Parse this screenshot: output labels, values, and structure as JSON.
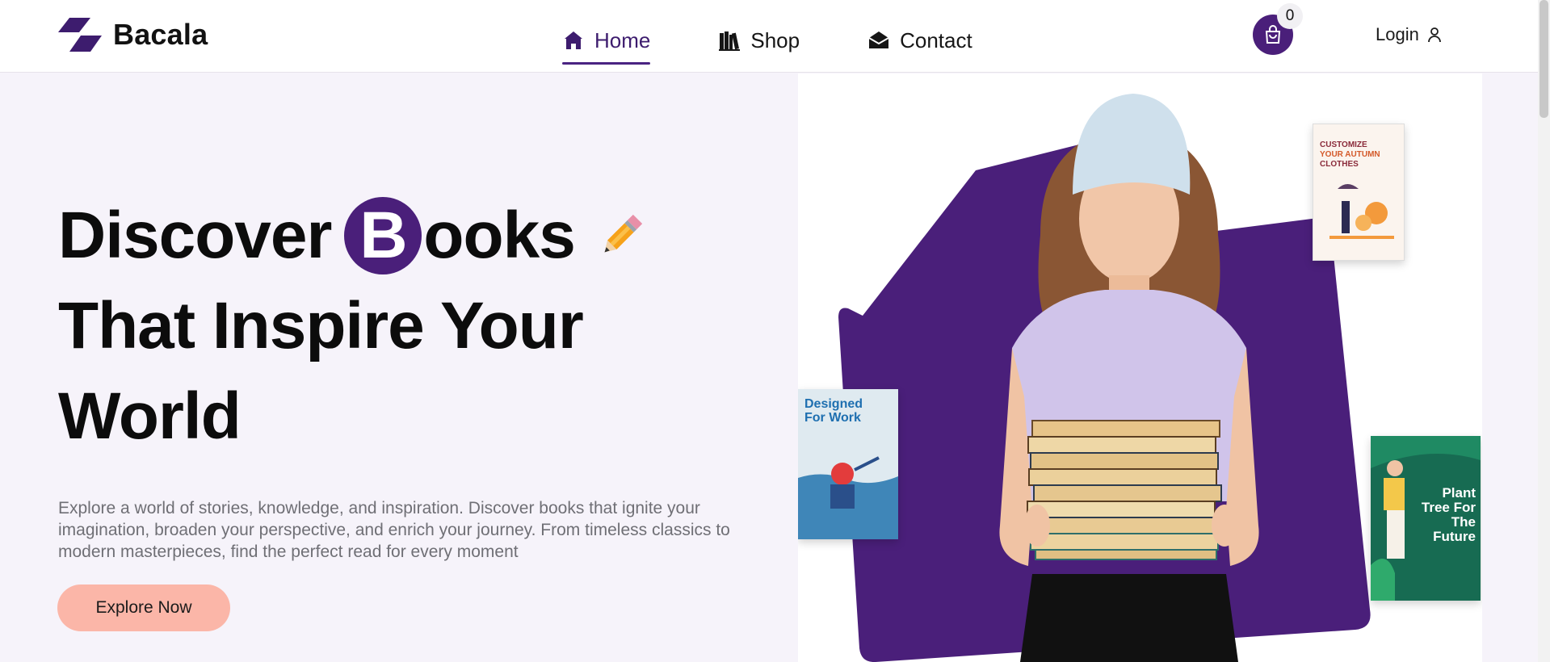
{
  "brand": {
    "name": "Bacala"
  },
  "nav": {
    "items": [
      {
        "label": "Home",
        "icon": "home-icon",
        "active": true
      },
      {
        "label": "Shop",
        "icon": "books-icon",
        "active": false
      },
      {
        "label": "Contact",
        "icon": "envelope-icon",
        "active": false
      }
    ]
  },
  "cart": {
    "count": "0",
    "icon": "shopping-bag-icon"
  },
  "account": {
    "login_label": "Login",
    "icon": "user-icon"
  },
  "hero": {
    "title_line1_start": "Discover ",
    "title_badge_letter": "B",
    "title_line1_end": "ooks",
    "title_line2": "That Inspire Your",
    "title_line3": "World",
    "title_emoji_icon": "pencil-icon",
    "description": "Explore a world of stories, knowledge, and inspiration. Discover books that ignite your imagination, broaden your perspective, and enrich your journey. From timeless classics to modern masterpieces, find the perfect read for every moment",
    "cta_label": "Explore Now"
  },
  "books": {
    "autumn": {
      "line1": "CUSTOMIZE",
      "line2": "YOUR AUTUMN",
      "line3": "CLOTHES"
    },
    "work": {
      "title": "Designed For Work"
    },
    "tree": {
      "title": "Plant Tree For The Future"
    }
  },
  "colors": {
    "brand_purple": "#4a1f7a",
    "cta_peach": "#fbb6a8",
    "page_bg": "#f6f3fa"
  }
}
